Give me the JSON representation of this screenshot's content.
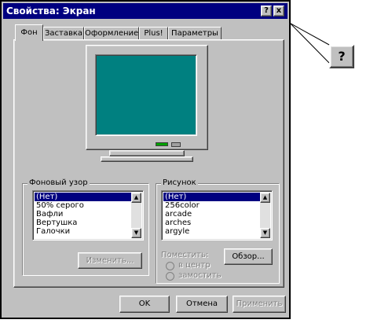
{
  "window": {
    "title": "Свойства: Экран"
  },
  "title_buttons": {
    "help": "?",
    "close": "x"
  },
  "callout": {
    "label": "?"
  },
  "tabs": [
    {
      "label": "Фон",
      "active": true
    },
    {
      "label": "Заставка"
    },
    {
      "label": "Оформление"
    },
    {
      "label": "Plus!"
    },
    {
      "label": "Параметры"
    }
  ],
  "monitor": {
    "screen_color": "#008080"
  },
  "pattern": {
    "legend": "Фоновый узор",
    "items": [
      "(Нет)",
      "50% серого",
      "Вафли",
      "Вертушка",
      "Галочки"
    ],
    "selected": 0,
    "edit_button": "Изменить..."
  },
  "wallpaper": {
    "legend": "Рисунок",
    "items": [
      "(Нет)",
      "256color",
      "arcade",
      "arches",
      "argyle"
    ],
    "selected": 0,
    "place_label": "Поместить:",
    "options": [
      "в центр",
      "замостить"
    ],
    "browse_button": "Обзор..."
  },
  "buttons": {
    "ok": "OK",
    "cancel": "Отмена",
    "apply": "Применить"
  }
}
